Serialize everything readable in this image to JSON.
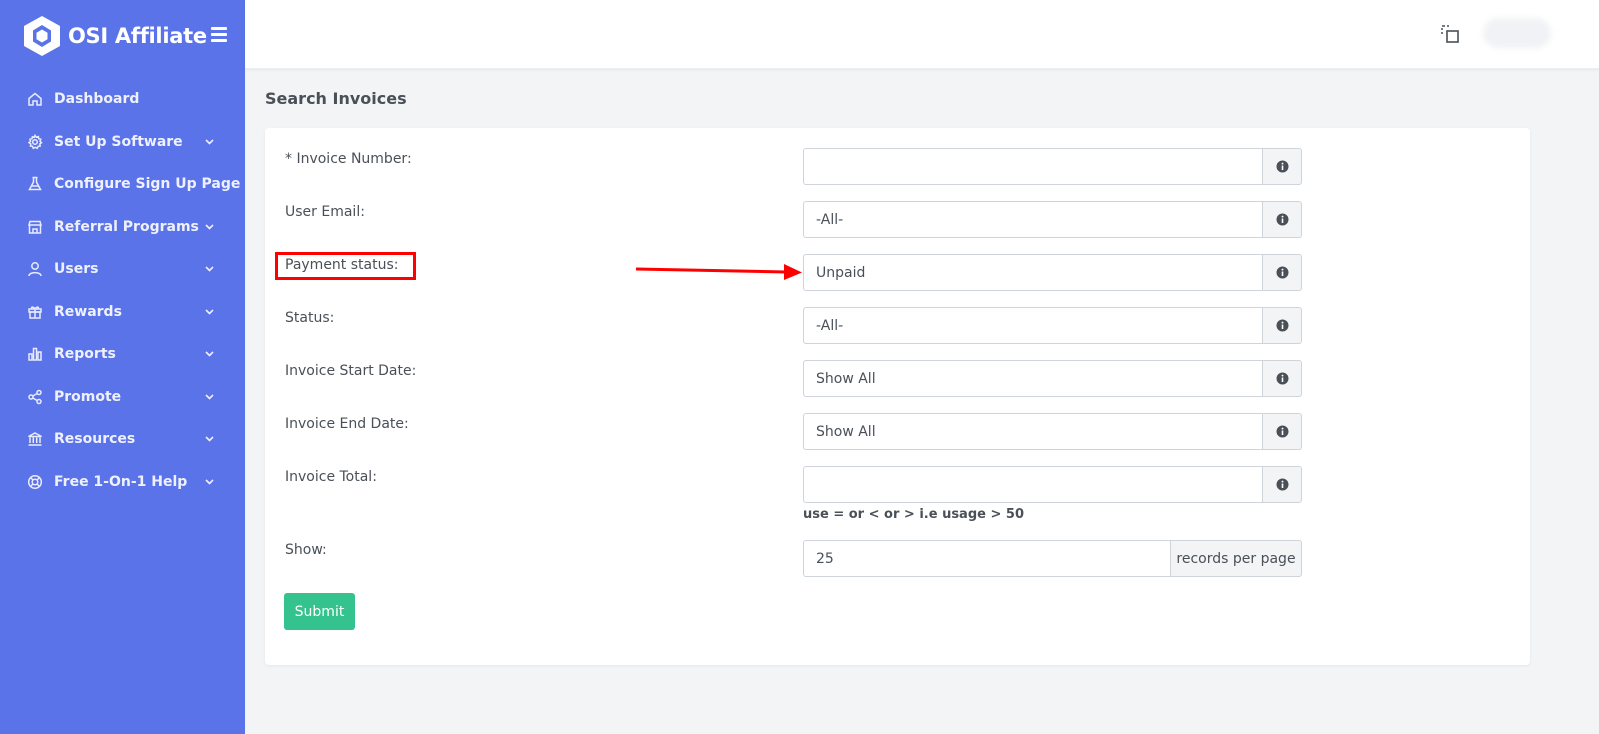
{
  "app": {
    "name": "OSI Affiliate"
  },
  "sidebar": {
    "items": [
      {
        "label": "Dashboard",
        "icon": "home-icon",
        "has_submenu": false
      },
      {
        "label": "Set Up Software",
        "icon": "gear-icon",
        "has_submenu": true
      },
      {
        "label": "Configure Sign Up Page",
        "icon": "flask-icon",
        "has_submenu": false
      },
      {
        "label": "Referral Programs",
        "icon": "store-icon",
        "has_submenu": true
      },
      {
        "label": "Users",
        "icon": "user-icon",
        "has_submenu": true
      },
      {
        "label": "Rewards",
        "icon": "gift-icon",
        "has_submenu": true
      },
      {
        "label": "Reports",
        "icon": "bar-chart-icon",
        "has_submenu": true
      },
      {
        "label": "Promote",
        "icon": "share-icon",
        "has_submenu": true
      },
      {
        "label": "Resources",
        "icon": "bank-icon",
        "has_submenu": true
      },
      {
        "label": "Free 1-On-1 Help",
        "icon": "lifebuoy-icon",
        "has_submenu": true
      }
    ]
  },
  "page": {
    "title": "Search Invoices"
  },
  "form": {
    "invoice_number": {
      "label": "* Invoice Number:",
      "value": ""
    },
    "user_email": {
      "label": "User Email:",
      "value": "-All-"
    },
    "payment_status": {
      "label": "Payment status:",
      "value": "Unpaid"
    },
    "status": {
      "label": "Status:",
      "value": "-All-"
    },
    "invoice_start_date": {
      "label": "Invoice Start Date:",
      "value": "Show All"
    },
    "invoice_end_date": {
      "label": "Invoice End Date:",
      "value": "Show All"
    },
    "invoice_total": {
      "label": "Invoice Total:",
      "value": "",
      "hint": "use = or < or > i.e usage > 50"
    },
    "show": {
      "label": "Show:",
      "value": "25",
      "suffix": "records per page"
    },
    "submit_label": "Submit"
  },
  "colors": {
    "sidebar": "#5b73e8",
    "submit": "#34c38f",
    "annotation": "#ff0000"
  }
}
